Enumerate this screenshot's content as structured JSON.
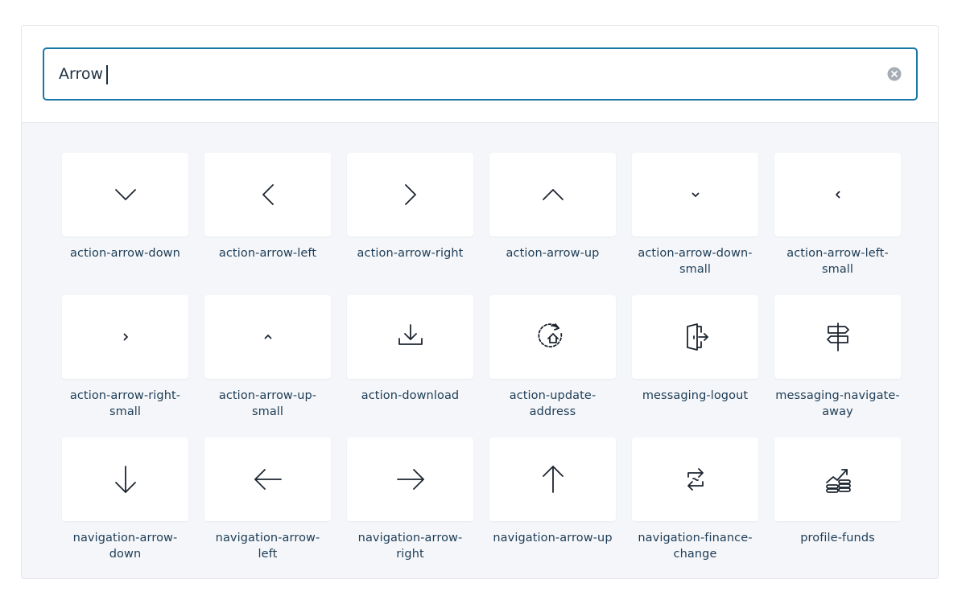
{
  "search": {
    "value": "Arrow",
    "clear_icon": "clear-circle-icon"
  },
  "icons": [
    {
      "label": "action-arrow-down",
      "icon": "chevron-down"
    },
    {
      "label": "action-arrow-left",
      "icon": "chevron-left"
    },
    {
      "label": "action-arrow-right",
      "icon": "chevron-right"
    },
    {
      "label": "action-arrow-up",
      "icon": "chevron-up"
    },
    {
      "label": "action-arrow-down-small",
      "icon": "chevron-down-small"
    },
    {
      "label": "action-arrow-left-small",
      "icon": "chevron-left-small"
    },
    {
      "label": "action-arrow-right-small",
      "icon": "chevron-right-small"
    },
    {
      "label": "action-arrow-up-small",
      "icon": "chevron-up-small"
    },
    {
      "label": "action-download",
      "icon": "download"
    },
    {
      "label": "action-update-address",
      "icon": "update-address"
    },
    {
      "label": "messaging-logout",
      "icon": "logout"
    },
    {
      "label": "messaging-navigate-away",
      "icon": "signpost"
    },
    {
      "label": "navigation-arrow-down",
      "icon": "arrow-down"
    },
    {
      "label": "navigation-arrow-left",
      "icon": "arrow-left"
    },
    {
      "label": "navigation-arrow-right",
      "icon": "arrow-right"
    },
    {
      "label": "navigation-arrow-up",
      "icon": "arrow-up"
    },
    {
      "label": "navigation-finance-change",
      "icon": "finance-change"
    },
    {
      "label": "profile-funds",
      "icon": "funds"
    }
  ]
}
